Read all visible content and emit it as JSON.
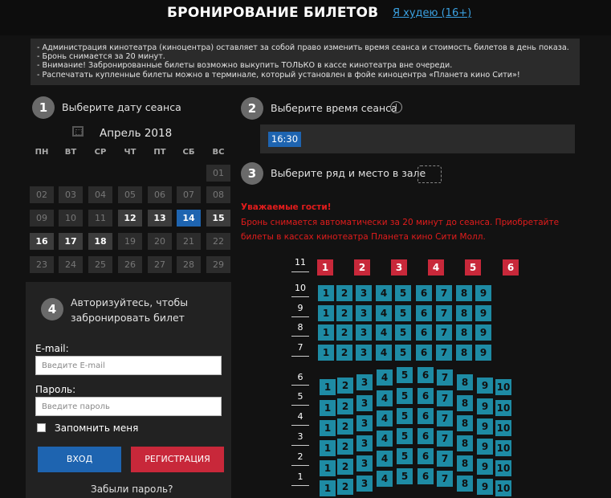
{
  "header": {
    "title": "БРОНИРОВАНИЕ БИЛЕТОВ",
    "vision_link": "Я худею (16+)"
  },
  "notice": [
    "- Администрация кинотеатра (киноцентра) оставляет за собой право изменить время сеанса и стоимость билетов в день показа.",
    "- Бронь снимается за 20 минут.",
    "- Внимание! Забронированные билеты возможно выкупить ТОЛЬКО в кассе кинотеатра вне очереди.",
    "- Распечатать купленные билеты можно в терминале, который установлен в фойе киноцентра «Планета кино Сити»!"
  ],
  "steps": {
    "date": {
      "num": "1",
      "label": "Выберите дату сеанса"
    },
    "time": {
      "num": "2",
      "label": "Выберите время сеанса"
    },
    "seat": {
      "num": "3",
      "label": "Выберите ряд и место в зале"
    },
    "auth": {
      "num": "4",
      "label_line1": "Авторизуйтесь, чтобы",
      "label_line2": "забронировать билет"
    }
  },
  "calendar": {
    "month": "Апрель 2018",
    "weekdays": [
      "ПН",
      "ВТ",
      "СР",
      "ЧТ",
      "ПТ",
      "СБ",
      "ВС"
    ],
    "weeks": [
      [
        "",
        "",
        "",
        "",
        "",
        "",
        "01"
      ],
      [
        "02",
        "03",
        "04",
        "05",
        "06",
        "07",
        "08"
      ],
      [
        "09",
        "10",
        "11",
        "12",
        "13",
        "14",
        "15"
      ],
      [
        "16",
        "17",
        "18",
        "19",
        "20",
        "21",
        "22"
      ],
      [
        "23",
        "24",
        "25",
        "26",
        "27",
        "28",
        "29"
      ]
    ],
    "available": [
      "12",
      "13",
      "15",
      "16",
      "17",
      "18"
    ],
    "selected": "14"
  },
  "times": [
    "16:30"
  ],
  "warning": {
    "title": "Уважаемые гости!",
    "text": "Бронь снимается автоматически за 20 минут до сеанса. Приобретайте билеты в кассах кинотеатра Планета кино Сити Молл."
  },
  "hall": {
    "rows": [
      {
        "row": "11",
        "seats": [
          "1",
          "2",
          "3",
          "4",
          "5",
          "6"
        ]
      },
      {
        "row": "10",
        "seats": [
          "1",
          "2",
          "3",
          "4",
          "5",
          "6",
          "7",
          "8",
          "9"
        ]
      },
      {
        "row": "9",
        "seats": [
          "1",
          "2",
          "3",
          "4",
          "5",
          "6",
          "7",
          "8",
          "9"
        ]
      },
      {
        "row": "8",
        "seats": [
          "1",
          "2",
          "3",
          "4",
          "5",
          "6",
          "7",
          "8",
          "9"
        ]
      },
      {
        "row": "7",
        "seats": [
          "1",
          "2",
          "3",
          "4",
          "5",
          "6",
          "7",
          "8",
          "9"
        ]
      },
      {
        "row": "6",
        "seats": [
          "1",
          "2",
          "3",
          "4",
          "5",
          "6",
          "7",
          "8",
          "9",
          "10"
        ]
      },
      {
        "row": "5",
        "seats": [
          "1",
          "2",
          "3",
          "4",
          "5",
          "6",
          "7",
          "8",
          "9",
          "10"
        ]
      },
      {
        "row": "4",
        "seats": [
          "1",
          "2",
          "3",
          "4",
          "5",
          "6",
          "7",
          "8",
          "9",
          "10"
        ]
      },
      {
        "row": "3",
        "seats": [
          "1",
          "2",
          "3",
          "4",
          "5",
          "6",
          "7",
          "8",
          "9",
          "10"
        ]
      },
      {
        "row": "2",
        "seats": [
          "1",
          "2",
          "3",
          "4",
          "5",
          "6",
          "7",
          "8",
          "9",
          "10"
        ]
      },
      {
        "row": "1",
        "seats": [
          "1",
          "2",
          "3",
          "4",
          "5",
          "6",
          "7",
          "8",
          "9",
          "10"
        ]
      }
    ]
  },
  "auth": {
    "email_label": "E-mail:",
    "email_placeholder": "Введите E-mail",
    "password_label": "Пароль:",
    "password_placeholder": "Введите пароль",
    "remember_label": "Запомнить меня",
    "login_button": "ВХОД",
    "register_button": "РЕГИСТРАЦИЯ",
    "forgot_link": "Забыли пароль?"
  },
  "colors": {
    "accent_blue": "#1e64b0",
    "seat_free": "#1e8ba4",
    "seat_vip": "#c8283a",
    "warning_red": "#e21c1c",
    "register_red": "#c8283a",
    "link_blue": "#3aa0e0"
  }
}
